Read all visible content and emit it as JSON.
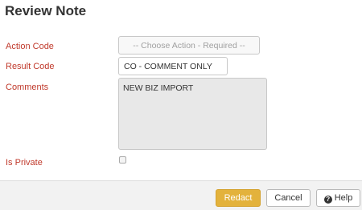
{
  "dialog": {
    "title": "Review Note"
  },
  "form": {
    "action_code": {
      "label": "Action Code",
      "value": "-- Choose Action - Required --"
    },
    "result_code": {
      "label": "Result Code",
      "value": "CO - COMMENT ONLY"
    },
    "comments": {
      "label": "Comments",
      "value": "NEW BIZ IMPORT"
    },
    "is_private": {
      "label": "Is Private",
      "checked": false
    }
  },
  "footer": {
    "redact_label": "Redact",
    "cancel_label": "Cancel",
    "help_label": "Help",
    "help_icon": "question-circle-icon"
  },
  "colors": {
    "label_text": "#c0392b",
    "primary_button": "#e3b23c",
    "footer_background": "#f2f2f2"
  }
}
